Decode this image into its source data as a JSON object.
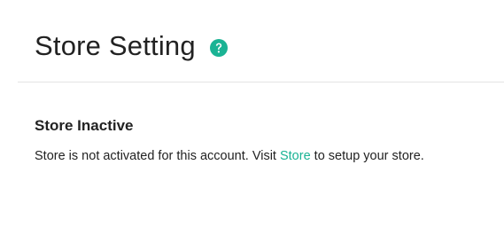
{
  "header": {
    "title": "Store Setting",
    "help_icon": "question-circle-icon"
  },
  "colors": {
    "accent": "#1ab394",
    "text": "#222222",
    "divider": "#e4e4e4"
  },
  "notice": {
    "title": "Store Inactive",
    "message_before": "Store is not activated for this account. Visit ",
    "link_label": "Store",
    "message_after": " to setup your store."
  }
}
